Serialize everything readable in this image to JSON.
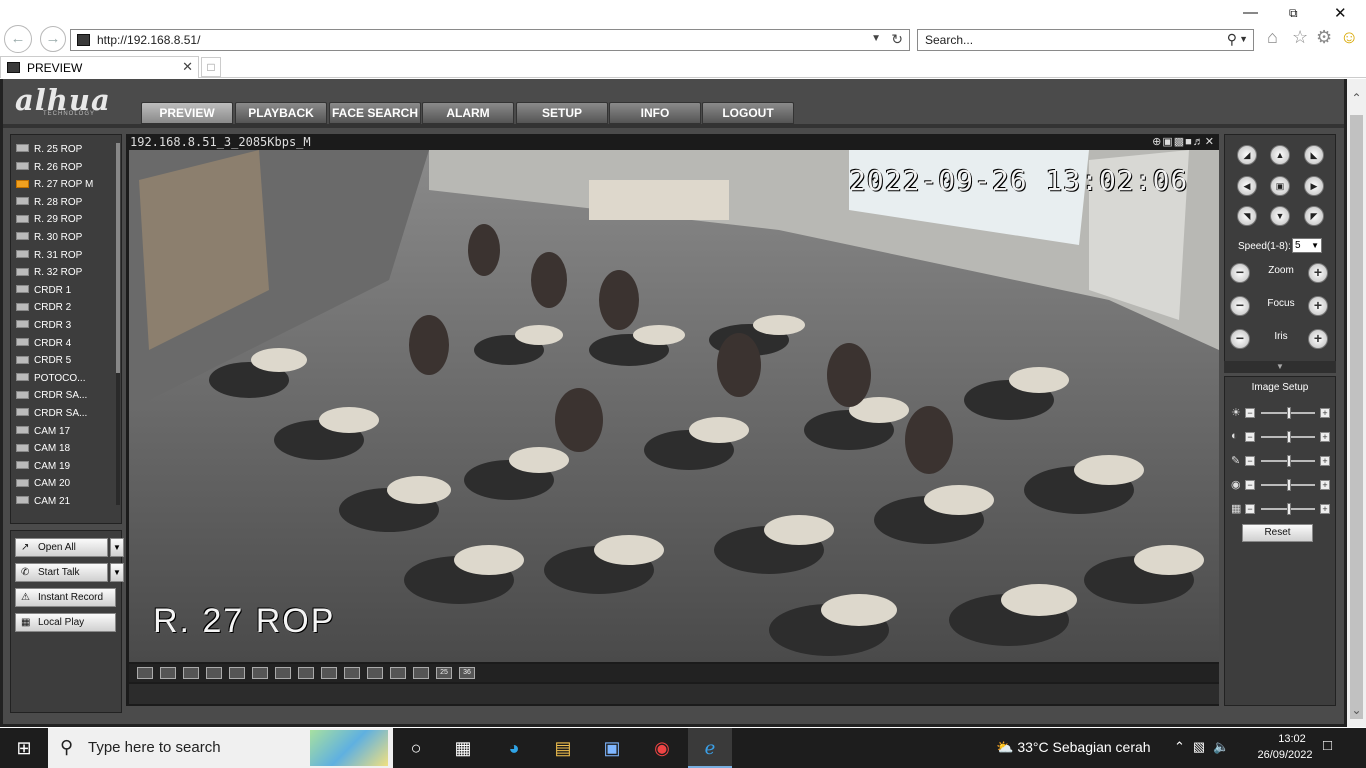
{
  "browser": {
    "url": "http://192.168.8.51/",
    "search_placeholder": "Search...",
    "tab_title": "PREVIEW"
  },
  "app": {
    "logo": "alhua",
    "logo_sub": "TECHNOLOGY",
    "nav": [
      {
        "label": "PREVIEW",
        "active": true
      },
      {
        "label": "PLAYBACK"
      },
      {
        "label": "FACE SEARCH"
      },
      {
        "label": "ALARM"
      },
      {
        "label": "SETUP"
      },
      {
        "label": "INFO"
      },
      {
        "label": "LOGOUT"
      }
    ],
    "channels": [
      "R. 25 ROP",
      "R. 26 ROP",
      "R. 27 ROP   M",
      "R. 28 ROP",
      "R. 29 ROP",
      "R. 30 ROP",
      "R. 31 ROP",
      "R. 32 ROP",
      "CRDR 1",
      "CRDR 2",
      "CRDR 3",
      "CRDR 4",
      "CRDR 5",
      "POTOCO...",
      "CRDR SA...",
      "CRDR SA...",
      "CAM 17",
      "CAM 18",
      "CAM 19",
      "CAM 20",
      "CAM 21"
    ],
    "selected_channel_index": 2,
    "controls": {
      "open_all": "Open All",
      "start_talk": "Start Talk",
      "instant_record": "Instant Record",
      "local_play": "Local Play"
    },
    "video": {
      "title": "192.168.8.51_3_2085Kbps_M",
      "timestamp": "2022-09-26 13:02:06",
      "channel_name": "R. 27 ROP"
    },
    "layouts": [
      "",
      "",
      "",
      "",
      "",
      "",
      "",
      "",
      "",
      "",
      "",
      "",
      "",
      "25",
      "36"
    ],
    "ptz": {
      "speed_label": "Speed(1-8):",
      "speed_value": "5",
      "zoom": "Zoom",
      "focus": "Focus",
      "iris": "Iris"
    },
    "image_setup": {
      "title": "Image Setup",
      "reset": "Reset"
    }
  },
  "taskbar": {
    "search_text": "Type here to search",
    "weather": "33°C  Sebagian cerah",
    "time": "13:02",
    "date": "26/09/2022"
  }
}
